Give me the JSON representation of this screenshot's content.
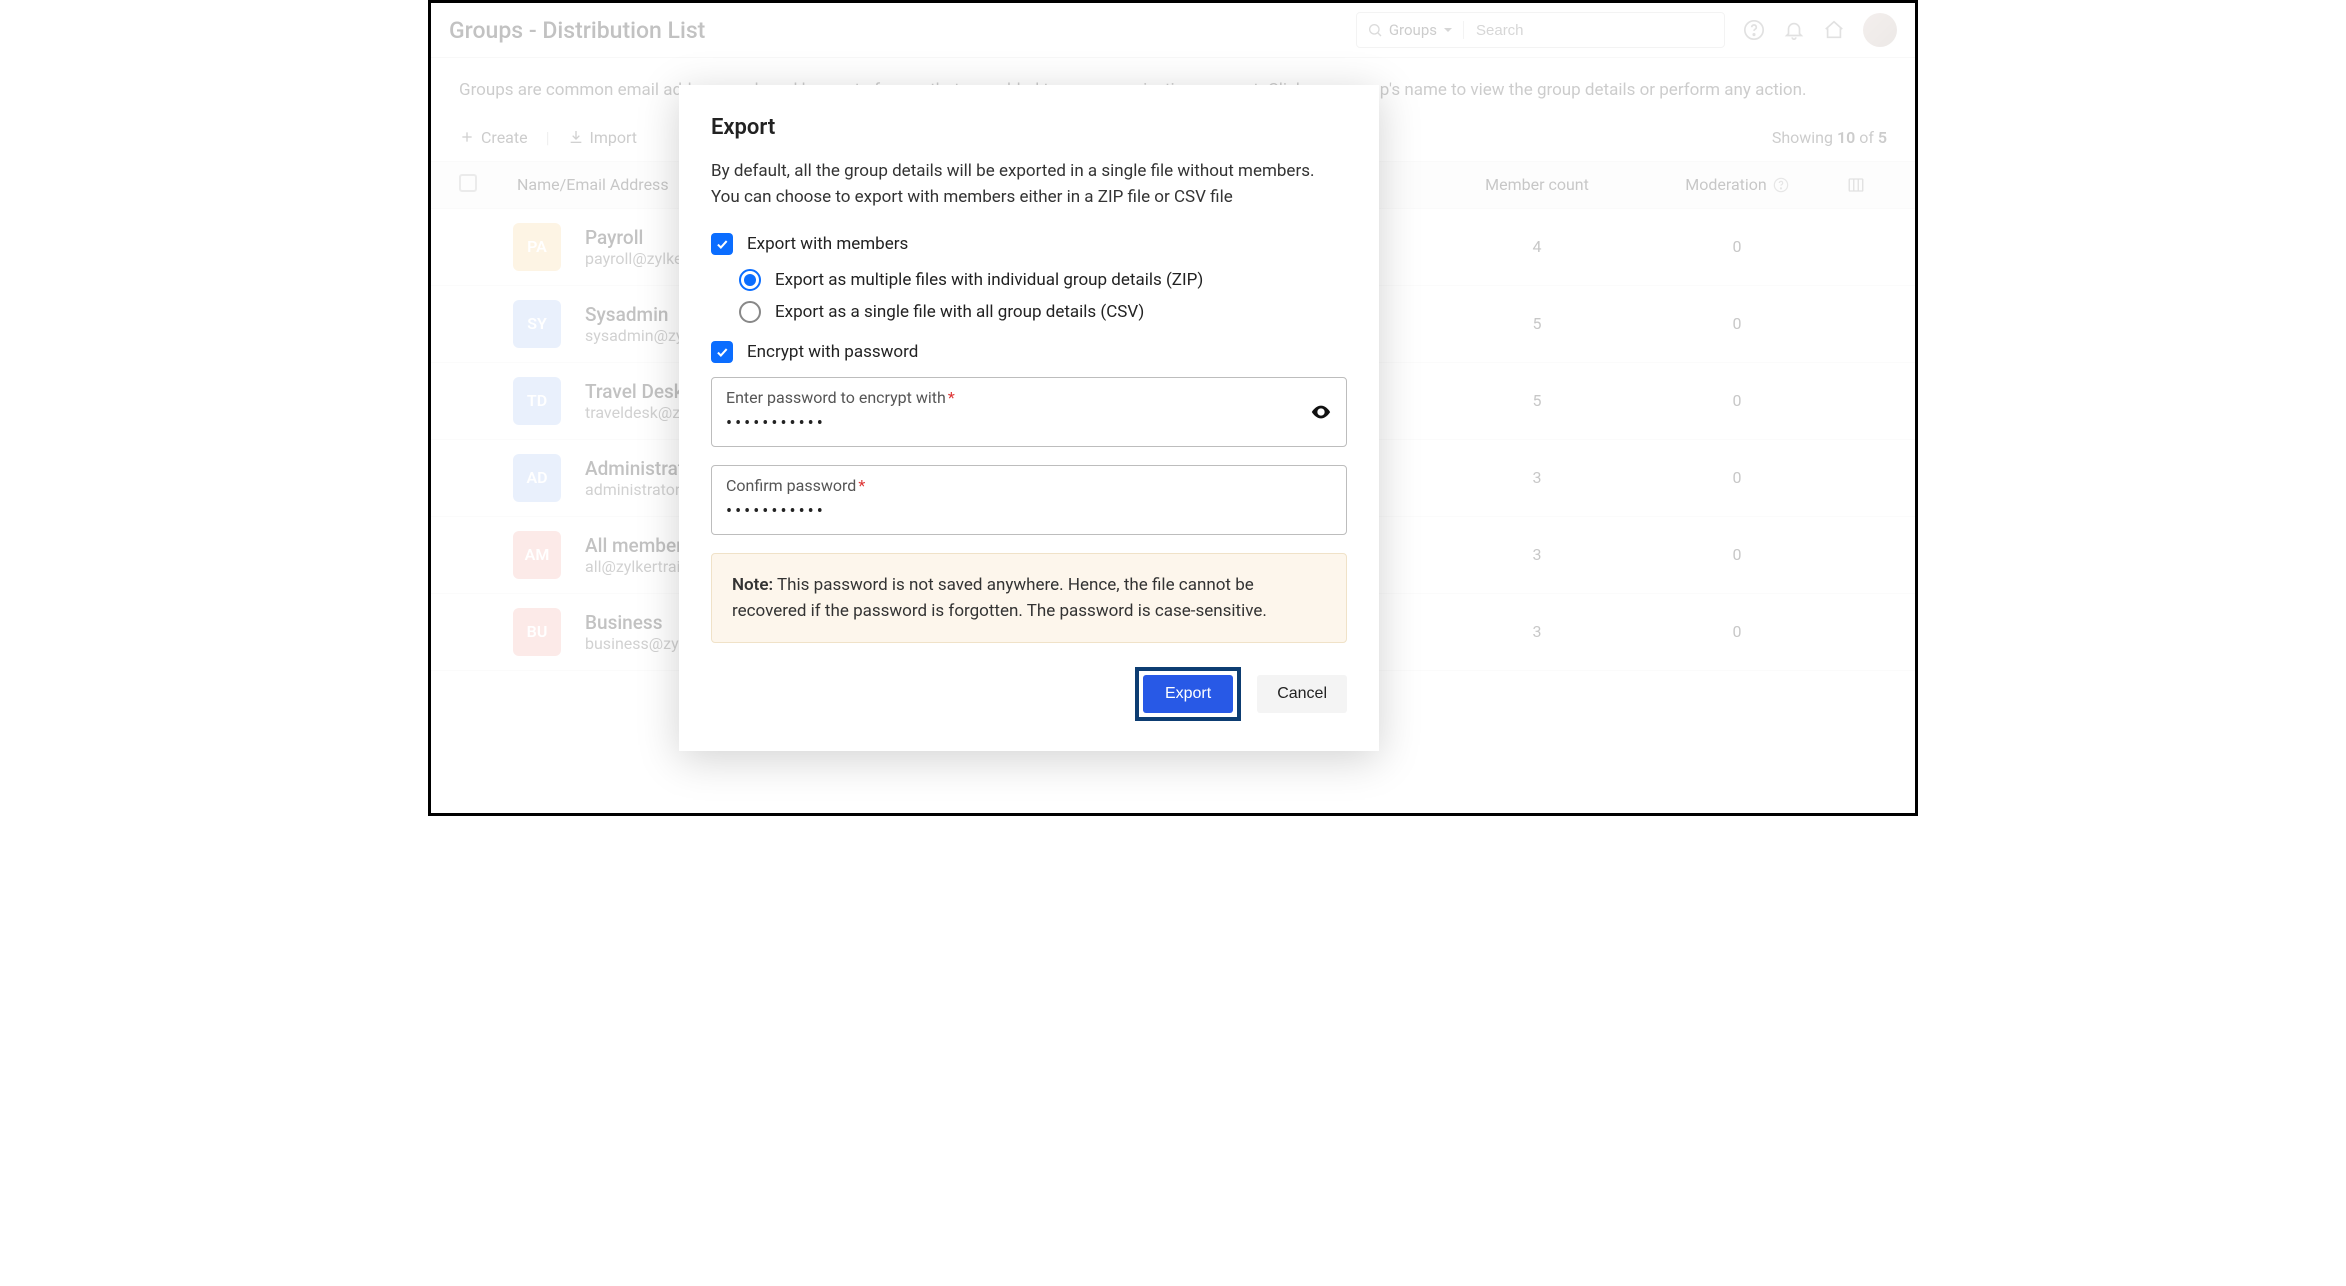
{
  "header": {
    "page_title": "Groups - Distribution List",
    "search_filter_label": "Groups",
    "search_placeholder": "Search"
  },
  "description": "Groups are common email addresses shared by a set of users that are added to your organization account. Click on a group's name to view the group details or perform any action.",
  "toolbar": {
    "create_label": "Create",
    "import_label": "Import",
    "showing_prefix": "Showing ",
    "showing_count": "10",
    "showing_of": " of ",
    "showing_total": "5"
  },
  "table": {
    "header_name": "Name/Email Address",
    "header_member": "Member count",
    "header_moderation": "Moderation"
  },
  "rows": [
    {
      "badge": "PA",
      "badge_color": "#f9d9a6",
      "name": "Payroll",
      "email": "payroll@zylkertraining.com",
      "member": "4",
      "mod": "0"
    },
    {
      "badge": "SY",
      "badge_color": "#b6cdf4",
      "name": "Sysadmin",
      "email": "sysadmin@zylkertraining.com",
      "member": "5",
      "mod": "0"
    },
    {
      "badge": "TD",
      "badge_color": "#b6cdf4",
      "name": "Travel Desk",
      "email": "traveldesk@zylkertraining.com",
      "member": "5",
      "mod": "0"
    },
    {
      "badge": "AD",
      "badge_color": "#b6cdf4",
      "name": "Administrators",
      "email": "administrators@zylkertraining.com",
      "member": "3",
      "mod": "0"
    },
    {
      "badge": "AM",
      "badge_color": "#f6b9b3",
      "name": "All members",
      "email": "all@zylkertraining.com",
      "member": "3",
      "mod": "0"
    },
    {
      "badge": "BU",
      "badge_color": "#f6b9b3",
      "name": "Business",
      "email": "business@zylkertraining.com",
      "member": "3",
      "mod": "0"
    }
  ],
  "modal": {
    "title": "Export",
    "description": "By default, all the group details will be exported in a single file without members. You can choose to export with members either in a ZIP file or CSV file",
    "export_with_members_label": "Export with members",
    "radio_zip_label": "Export as multiple files with individual group details (ZIP)",
    "radio_csv_label": "Export as a single file with all group details (CSV)",
    "encrypt_label": "Encrypt with password",
    "pw_label": "Enter password to encrypt with",
    "pw_req": "*",
    "pw_value": "•••••••••••",
    "confirm_pw_label": "Confirm password",
    "confirm_pw_value": "•••••••••••",
    "note_prefix": "Note:",
    "note_text": " This password is not saved anywhere. Hence, the file cannot be recovered if the password is forgotten. The password is case-sensitive.",
    "export_button": "Export",
    "cancel_button": "Cancel"
  }
}
